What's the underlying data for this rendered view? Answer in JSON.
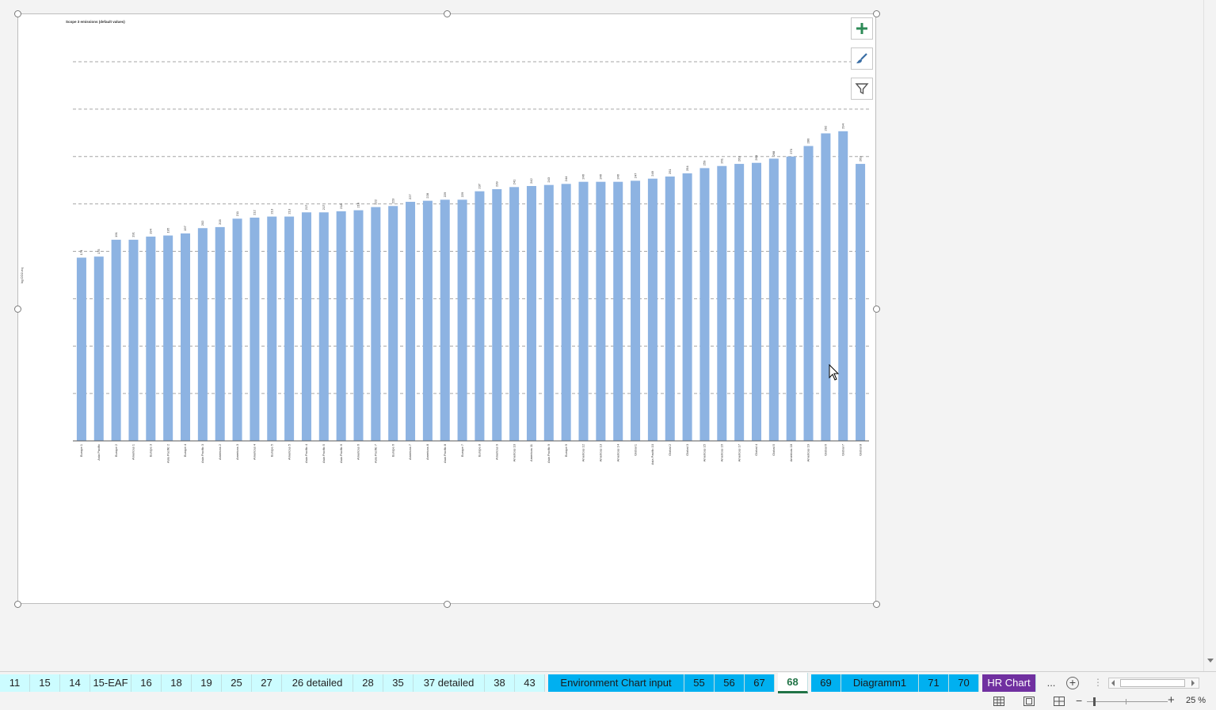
{
  "chart_data": {
    "type": "bar",
    "title": "Scope 3 emissions (default values)",
    "ylabel": "kg CO2-eq",
    "xlabel": "",
    "ylim": [
      0,
      360
    ],
    "grid": true,
    "legend": "none",
    "bar_color": "#8db3e2",
    "categories": [
      "Europe 1",
      "Asia Pacific",
      "Europe 2",
      "Americas 1",
      "Europe 3",
      "Asia Pacific 2",
      "Europe 4",
      "Asia Pacific 3",
      "Americas 2",
      "Americas 3",
      "Americas 4",
      "Europe 5",
      "Americas 5",
      "Asia Pacific 4",
      "Asia Pacific 5",
      "Asia Pacific 6",
      "Americas 6",
      "Asia Pacific 7",
      "Europe 6",
      "Americas 7",
      "Americas 8",
      "Asia Pacific 8",
      "Europe 7",
      "Europe 8",
      "Americas 9",
      "Americas 10",
      "Americas 11",
      "Asia Pacific 9",
      "Europe 9",
      "Americas 12",
      "Americas 13",
      "Americas 14",
      "Global 1",
      "Asia Pacific 10",
      "Global 2",
      "Global 3",
      "Americas 15",
      "Americas 16",
      "Americas 17",
      "Global 4",
      "Global 5",
      "Americas 18",
      "Americas 19",
      "Global 6",
      "Global 7",
      "Global 8"
    ],
    "values": [
      174,
      175,
      191,
      191,
      194,
      195,
      197,
      202,
      203,
      211,
      212,
      213,
      213,
      217,
      217,
      218,
      219,
      222,
      223,
      227,
      228,
      229,
      229,
      237,
      239,
      241,
      242,
      243,
      244,
      246,
      246,
      246,
      247,
      249,
      251,
      254,
      259,
      261,
      263,
      264,
      268,
      270,
      280,
      292,
      294,
      263
    ],
    "data_labels": [
      "174",
      "175",
      "191",
      "191",
      "194",
      "195",
      "197",
      "202",
      "203",
      "211",
      "212",
      "213",
      "213",
      "217",
      "217",
      "218",
      "219",
      "222",
      "223",
      "227",
      "228",
      "229",
      "229",
      "237",
      "239",
      "241",
      "242",
      "243",
      "244",
      "246",
      "246",
      "246",
      "247",
      "249",
      "251",
      "254",
      "259",
      "261",
      "263",
      "264",
      "268",
      "270",
      "280",
      "292",
      "294",
      "263"
    ]
  },
  "sheet_tabs": [
    {
      "label": "11",
      "color": "cyan"
    },
    {
      "label": "15",
      "color": "cyan"
    },
    {
      "label": "14",
      "color": "cyan"
    },
    {
      "label": "15-EAF",
      "color": "cyan"
    },
    {
      "label": "16",
      "color": "cyan"
    },
    {
      "label": "18",
      "color": "cyan"
    },
    {
      "label": "19",
      "color": "cyan"
    },
    {
      "label": "25",
      "color": "cyan"
    },
    {
      "label": "27",
      "color": "cyan"
    },
    {
      "label": "26 detailed",
      "color": "cyan"
    },
    {
      "label": "28",
      "color": "cyan"
    },
    {
      "label": "35",
      "color": "cyan"
    },
    {
      "label": "37 detailed",
      "color": "cyan"
    },
    {
      "label": "38",
      "color": "cyan"
    },
    {
      "label": "43",
      "color": "cyan"
    },
    {
      "label": "Environment Chart input",
      "color": "blue"
    },
    {
      "label": "55",
      "color": "blue"
    },
    {
      "label": "56",
      "color": "blue"
    },
    {
      "label": "67",
      "color": "blue"
    },
    {
      "label": "68",
      "color": "active"
    },
    {
      "label": "69",
      "color": "blue"
    },
    {
      "label": "Diagramm1",
      "color": "blue"
    },
    {
      "label": "71",
      "color": "blue"
    },
    {
      "label": "70",
      "color": "blue"
    },
    {
      "label": "HR Chart",
      "color": "purple"
    }
  ],
  "tab_bar": {
    "more_label": "...",
    "add_label": "+",
    "separator": "⋮"
  },
  "status_bar": {
    "zoom_level": "25 %",
    "zoom_minus": "−",
    "zoom_plus": "+"
  },
  "chart_buttons": {
    "elements_icon": "plus-icon",
    "styles_icon": "paintbrush-icon",
    "filters_icon": "funnel-icon"
  },
  "colors": {
    "accent_green": "#217346",
    "tab_cyan": "#ccfcff",
    "tab_blue": "#00b0f0",
    "tab_purple": "#7030a0"
  }
}
